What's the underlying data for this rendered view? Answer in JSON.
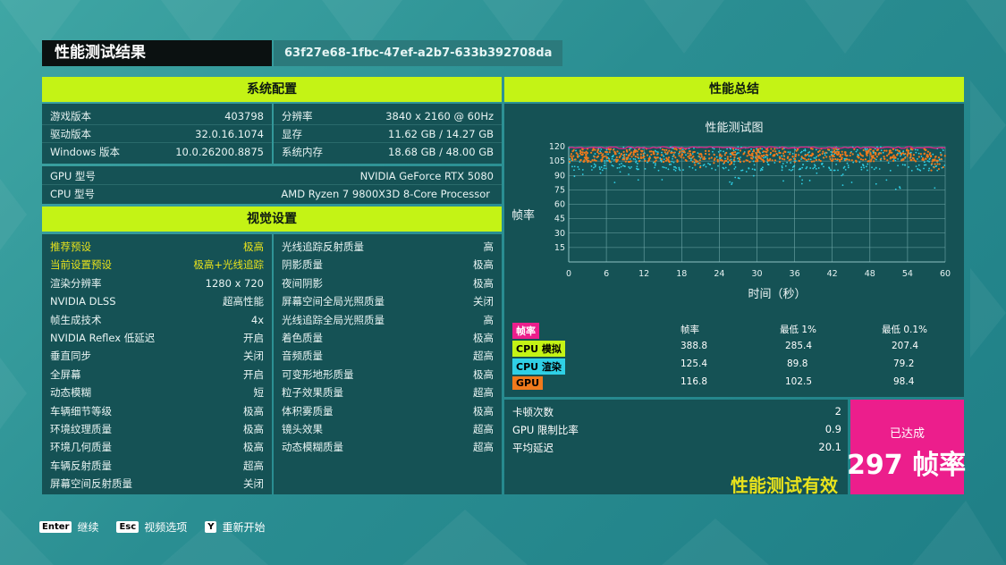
{
  "header": {
    "title": "性能测试结果",
    "run_id": "63f27e68-1fbc-47ef-a2b7-633b392708da"
  },
  "system": {
    "heading": "系统配置",
    "left": [
      {
        "k": "游戏版本",
        "v": "403798"
      },
      {
        "k": "驱动版本",
        "v": "32.0.16.1074"
      },
      {
        "k": "Windows 版本",
        "v": "10.0.26200.8875"
      }
    ],
    "right": [
      {
        "k": "分辨率",
        "v": "3840 x 2160 @ 60Hz"
      },
      {
        "k": "显存",
        "v": "11.62 GB / 14.27 GB"
      },
      {
        "k": "系统内存",
        "v": "18.68 GB / 48.00 GB"
      }
    ],
    "gpu": {
      "k": "GPU 型号",
      "v": "NVIDIA GeForce RTX 5080"
    },
    "cpu": {
      "k": "CPU 型号",
      "v": "AMD Ryzen 7 9800X3D 8-Core Processor"
    }
  },
  "visual": {
    "heading": "视觉设置",
    "left": [
      {
        "k": "推荐预设",
        "v": "极高",
        "hl": true
      },
      {
        "k": "当前设置预设",
        "v": "极高+光线追踪",
        "hl": true
      },
      {
        "k": "渲染分辨率",
        "v": "1280 x 720"
      },
      {
        "k": "NVIDIA DLSS",
        "v": "超高性能"
      },
      {
        "k": "帧生成技术",
        "v": "4x"
      },
      {
        "k": "NVIDIA Reflex 低延迟",
        "v": "开启"
      },
      {
        "k": "垂直同步",
        "v": "关闭"
      },
      {
        "k": "全屏幕",
        "v": "开启"
      },
      {
        "k": "动态模糊",
        "v": "短"
      },
      {
        "k": "车辆细节等级",
        "v": "极高"
      },
      {
        "k": "环境纹理质量",
        "v": "极高"
      },
      {
        "k": "环境几何质量",
        "v": "极高"
      },
      {
        "k": "车辆反射质量",
        "v": "超高"
      },
      {
        "k": "屏幕空间反射质量",
        "v": "关闭"
      }
    ],
    "right": [
      {
        "k": "光线追踪反射质量",
        "v": "高"
      },
      {
        "k": "阴影质量",
        "v": "极高"
      },
      {
        "k": "夜间阴影",
        "v": "极高"
      },
      {
        "k": "屏幕空间全局光照质量",
        "v": "关闭"
      },
      {
        "k": "光线追踪全局光照质量",
        "v": "高"
      },
      {
        "k": "着色质量",
        "v": "极高"
      },
      {
        "k": "音频质量",
        "v": "超高"
      },
      {
        "k": "可变形地形质量",
        "v": "极高"
      },
      {
        "k": "粒子效果质量",
        "v": "超高"
      },
      {
        "k": "体积雾质量",
        "v": "极高"
      },
      {
        "k": "镜头效果",
        "v": "超高"
      },
      {
        "k": "动态模糊质量",
        "v": "超高"
      }
    ]
  },
  "summary": {
    "heading": "性能总结",
    "legend_headers": [
      "帧率",
      "最低 1%",
      "最低 0.1%"
    ],
    "legend": [
      {
        "name": "帧率",
        "color": "#ec1e8c",
        "fps": "",
        "low1": "",
        "low01": ""
      },
      {
        "name": "CPU 模拟",
        "color": "#c4f315",
        "fps": "388.8",
        "low1": "285.4",
        "low01": "207.4"
      },
      {
        "name": "CPU 渲染",
        "color": "#2fd0e6",
        "fps": "125.4",
        "low1": "89.8",
        "low01": "79.2"
      },
      {
        "name": "GPU",
        "color": "#f07a1c",
        "fps": "116.8",
        "low1": "102.5",
        "low01": "98.4"
      }
    ],
    "stats": [
      {
        "k": "卡顿次数",
        "v": "2"
      },
      {
        "k": "GPU 限制比率",
        "v": "0.9"
      },
      {
        "k": "平均延迟",
        "v": "20.1"
      }
    ],
    "valid_text": "性能测试有效",
    "achieved_label": "已达成",
    "achieved_value": "297 帧率"
  },
  "chart_data": {
    "type": "scatter",
    "title": "性能测试图",
    "xlabel": "时间（秒）",
    "ylabel": "帧率",
    "xlim": [
      0,
      60
    ],
    "ylim": [
      0,
      120
    ],
    "x_ticks": [
      "0",
      "6",
      "12",
      "18",
      "24",
      "30",
      "36",
      "42",
      "48",
      "54",
      "60"
    ],
    "y_ticks": [
      "15",
      "30",
      "45",
      "60",
      "75",
      "90",
      "105",
      "120"
    ],
    "grid": true,
    "series": [
      {
        "name": "CPU 渲染",
        "color": "#2fd0e6",
        "band": [
          95,
          120
        ]
      },
      {
        "name": "GPU",
        "color": "#f07a1c",
        "band": [
          104,
          118
        ]
      },
      {
        "name": "帧率",
        "color": "#ec1e8c",
        "band": [
          118,
          120
        ]
      }
    ]
  },
  "footer": [
    {
      "key": "Enter",
      "label": "继续"
    },
    {
      "key": "Esc",
      "label": "视频选项"
    },
    {
      "key": "Y",
      "label": "重新开始"
    }
  ]
}
